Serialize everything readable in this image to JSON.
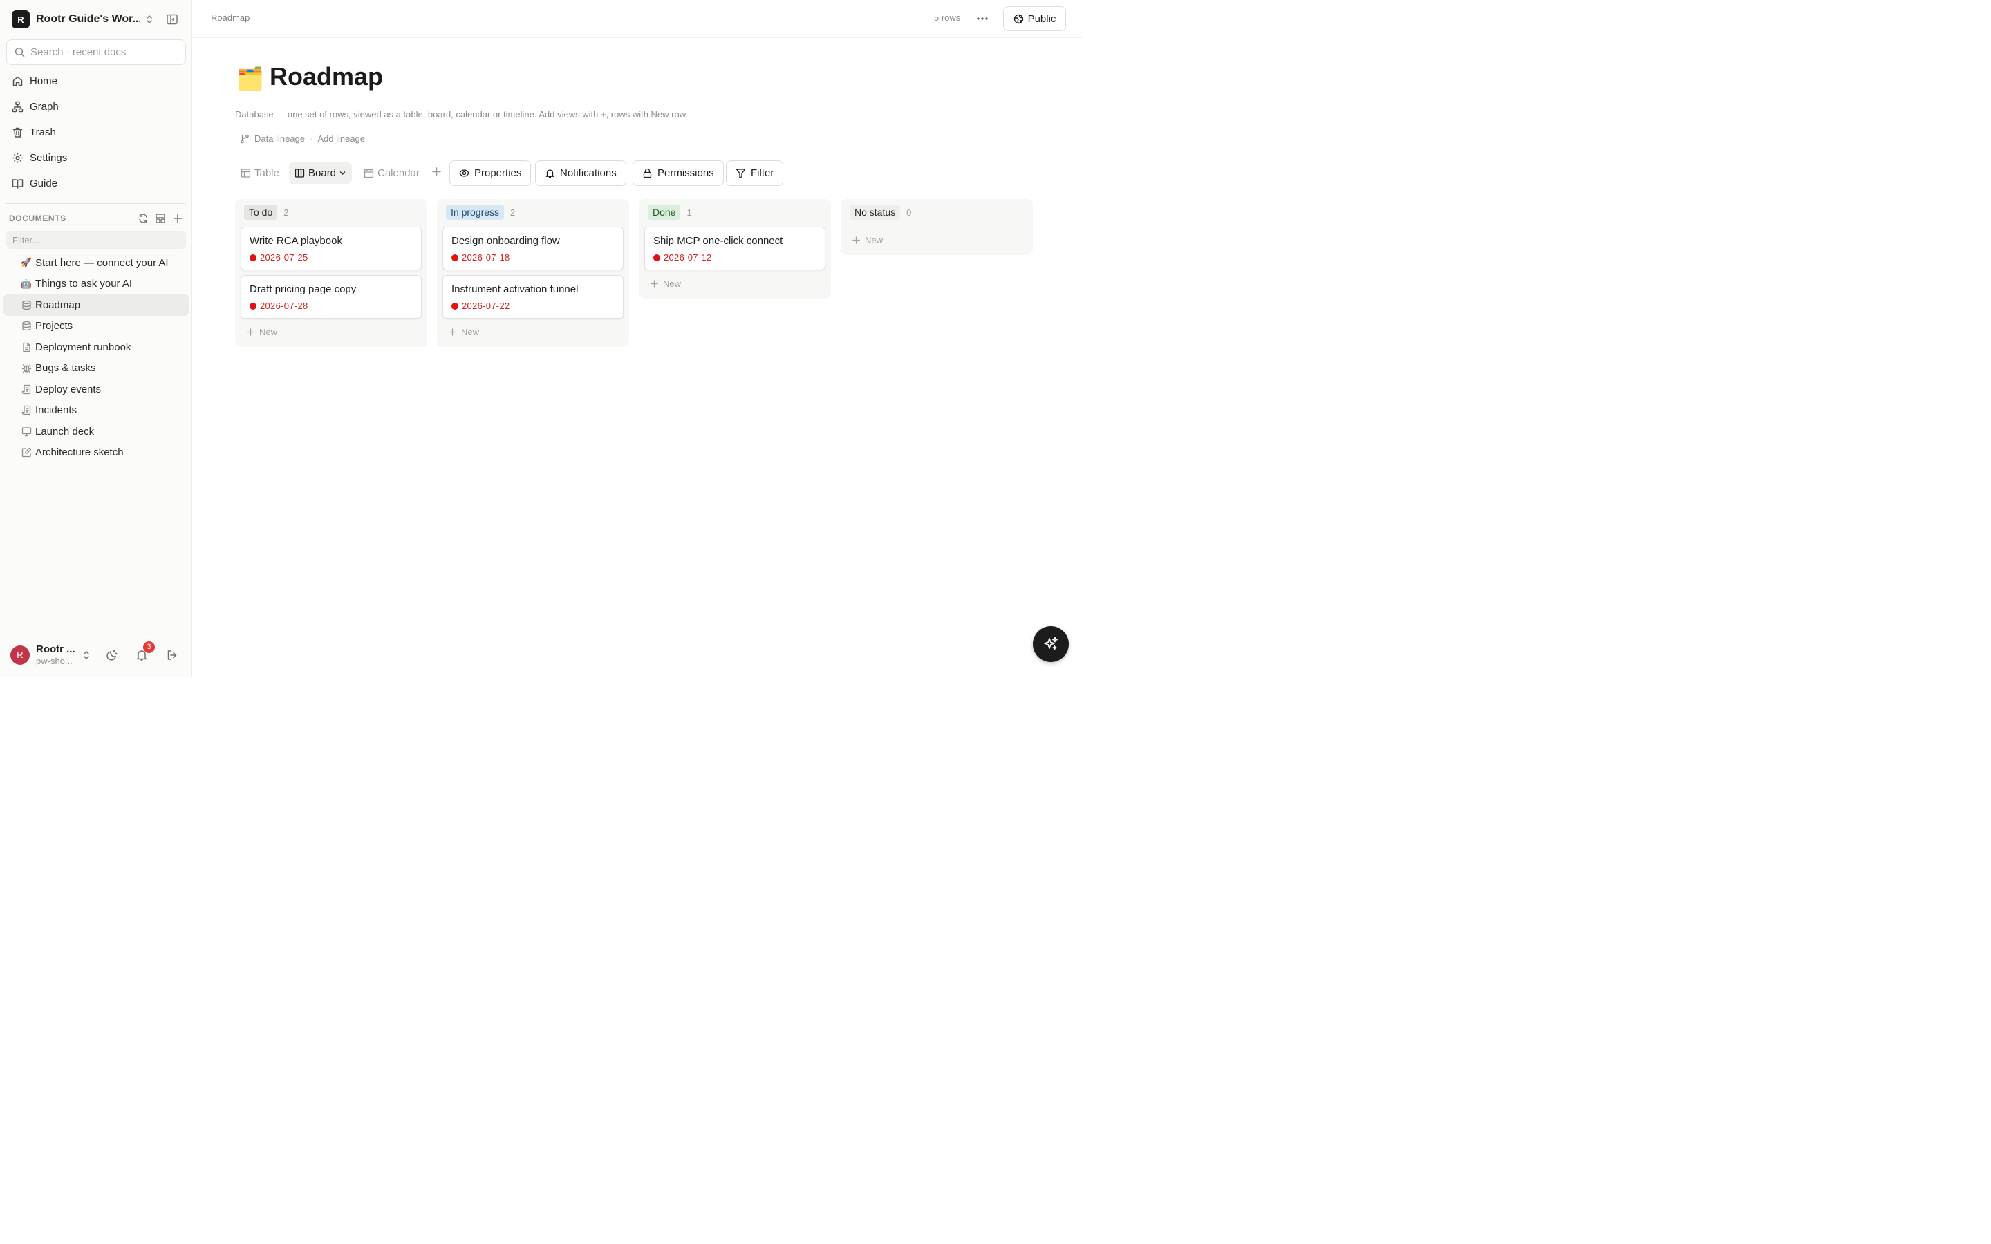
{
  "workspace": {
    "badge": "R",
    "name": "Rootr Guide's Wor..."
  },
  "search": {
    "placeholder": "Search · recent docs"
  },
  "nav": [
    {
      "label": "Home",
      "icon": "home-icon"
    },
    {
      "label": "Graph",
      "icon": "graph-icon"
    },
    {
      "label": "Trash",
      "icon": "trash-icon"
    },
    {
      "label": "Settings",
      "icon": "gear-icon"
    },
    {
      "label": "Guide",
      "icon": "book-icon"
    }
  ],
  "documents": {
    "heading": "DOCUMENTS",
    "filter_placeholder": "Filter...",
    "items": [
      {
        "label": "Start here — connect your AI",
        "icon": "🚀"
      },
      {
        "label": "Things to ask your AI",
        "icon": "🤖"
      },
      {
        "label": "Roadmap",
        "icon": "database-icon",
        "active": true
      },
      {
        "label": "Projects",
        "icon": "database-icon"
      },
      {
        "label": "Deployment runbook",
        "icon": "page-icon"
      },
      {
        "label": "Bugs & tasks",
        "icon": "bug-icon"
      },
      {
        "label": "Deploy events",
        "icon": "log-icon"
      },
      {
        "label": "Incidents",
        "icon": "log-icon"
      },
      {
        "label": "Launch deck",
        "icon": "presentation-icon"
      },
      {
        "label": "Architecture sketch",
        "icon": "pencil-icon"
      }
    ]
  },
  "user": {
    "initial": "R",
    "name": "Rootr ...",
    "sub": "pw-sho...",
    "notifications": "3"
  },
  "topbar": {
    "breadcrumb": "Roadmap",
    "rows": "5 rows",
    "public_label": "Public"
  },
  "page": {
    "emoji": "🗂️",
    "title": "Roadmap",
    "description": "Database — one set of rows, viewed as a table, board, calendar or timeline. Add views with +, rows with New row.",
    "lineage_label": "Data lineage",
    "add_lineage": "Add lineage"
  },
  "views": {
    "tabs": [
      {
        "label": "Table",
        "icon": "table-icon"
      },
      {
        "label": "Board",
        "icon": "board-icon",
        "active": true
      },
      {
        "label": "Calendar",
        "icon": "calendar-icon"
      }
    ],
    "buttons": {
      "properties": "Properties",
      "notifications": "Notifications",
      "permissions": "Permissions",
      "filter": "Filter"
    }
  },
  "board": {
    "new_label": "New",
    "columns": [
      {
        "name": "To do",
        "count": "2",
        "color": "#e5e5e3",
        "text_color": "#2a2a2a",
        "cards": [
          {
            "title": "Write RCA playbook",
            "date": "2026-07-25"
          },
          {
            "title": "Draft pricing page copy",
            "date": "2026-07-28"
          }
        ]
      },
      {
        "name": "In progress",
        "count": "2",
        "color": "#d7e7f4",
        "text_color": "#1f4a6e",
        "cards": [
          {
            "title": "Design onboarding flow",
            "date": "2026-07-18"
          },
          {
            "title": "Instrument activation funnel",
            "date": "2026-07-22"
          }
        ]
      },
      {
        "name": "Done",
        "count": "1",
        "color": "#dcefdc",
        "text_color": "#245a2a",
        "cards": [
          {
            "title": "Ship MCP one-click connect",
            "date": "2026-07-12"
          }
        ]
      },
      {
        "name": "No status",
        "count": "0",
        "color": "#eeeeec",
        "text_color": "#2a2a2a",
        "cards": []
      }
    ]
  },
  "colors": {
    "date_overdue": "#e11212",
    "accent_dark": "#1c1c1c"
  }
}
